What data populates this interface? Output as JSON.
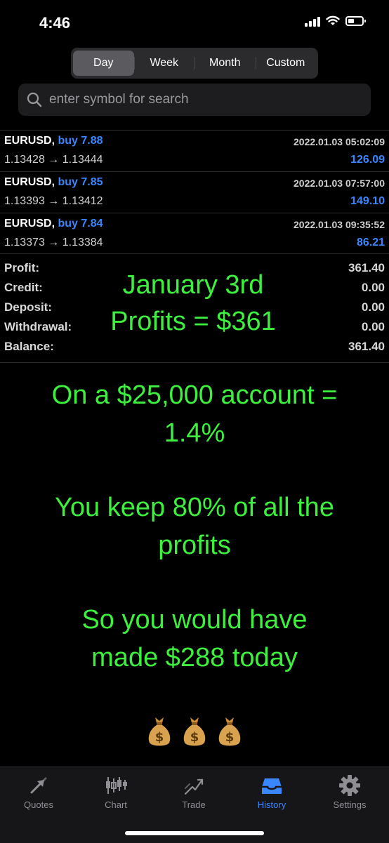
{
  "status_bar": {
    "time": "4:46"
  },
  "period_tabs": [
    {
      "label": "Day",
      "active": true
    },
    {
      "label": "Week",
      "active": false
    },
    {
      "label": "Month",
      "active": false
    },
    {
      "label": "Custom",
      "active": false
    }
  ],
  "search": {
    "placeholder": "enter symbol for search",
    "value": ""
  },
  "deals": [
    {
      "symbol": "EURUSD,",
      "side": "buy 7.88",
      "prices": "1.13428 → 1.13444",
      "datetime": "2022.01.03 05:02:09",
      "profit": "126.09"
    },
    {
      "symbol": "EURUSD,",
      "side": "buy 7.85",
      "prices": "1.13393 → 1.13412",
      "datetime": "2022.01.03 07:57:00",
      "profit": "149.10"
    },
    {
      "symbol": "EURUSD,",
      "side": "buy 7.84",
      "prices": "1.13373 → 1.13384",
      "datetime": "2022.01.03 09:35:52",
      "profit": "86.21"
    }
  ],
  "summary": [
    {
      "label": "Profit:",
      "value": "361.40"
    },
    {
      "label": "Credit:",
      "value": "0.00"
    },
    {
      "label": "Deposit:",
      "value": "0.00"
    },
    {
      "label": "Withdrawal:",
      "value": "0.00"
    },
    {
      "label": "Balance:",
      "value": "361.40"
    }
  ],
  "overlay": {
    "line1": "January 3rd",
    "line2": "Profits = $361",
    "line3": "On a $25,000 account =",
    "line4": "1.4%",
    "line5": "You keep 80% of all the",
    "line6": "profits",
    "line7": "So you would have",
    "line8": "made $288 today"
  },
  "money_bags": [
    {
      "icon": "money-bag-icon",
      "symbol": "$"
    },
    {
      "icon": "money-bag-icon",
      "symbol": "$"
    },
    {
      "icon": "money-bag-icon",
      "symbol": "$"
    }
  ],
  "tab_bar": [
    {
      "label": "Quotes",
      "icon": "quotes-icon",
      "active": false
    },
    {
      "label": "Chart",
      "icon": "chart-icon",
      "active": false
    },
    {
      "label": "Trade",
      "icon": "trade-icon",
      "active": false
    },
    {
      "label": "History",
      "icon": "history-icon",
      "active": true
    },
    {
      "label": "Settings",
      "icon": "settings-icon",
      "active": false
    }
  ],
  "colors": {
    "accent_blue": "#3a86ff",
    "overlay_green": "#3ef03e",
    "background": "#000000"
  }
}
